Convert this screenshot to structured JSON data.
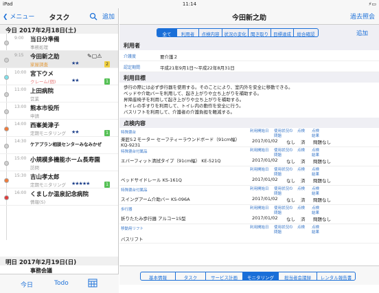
{
  "status": {
    "device": "iPad",
    "time": "11:14"
  },
  "left": {
    "back": "メニュー",
    "title": "タスク",
    "add": "追加",
    "day1": "今日 2017年2月18日(土)",
    "tasks": [
      {
        "time": "9:00",
        "name": "当日分準備",
        "sub": "事務処理",
        "stars": "",
        "badge": "",
        "dot": "#cfcfcf",
        "subcolor": "#999",
        "icons": ""
      },
      {
        "time": "9:15",
        "name": "今田新之助",
        "sub": "家屋調査",
        "stars": "★★",
        "badge": "2",
        "dot": "#cfcfcf",
        "subcolor": "#e39a3a",
        "icons": "✎▢⚠"
      },
      {
        "time": "10:00",
        "name": "宮下ウメ",
        "sub": "クレーム(個)",
        "stars": "★★",
        "badge": "1",
        "dot": "#7fe0ea",
        "subcolor": "#e57a7a",
        "icons": ""
      },
      {
        "time": "11:00",
        "name": "上田病院",
        "sub": "営業",
        "stars": "",
        "badge": "",
        "dot": "#cfcfcf",
        "subcolor": "#999",
        "icons": ""
      },
      {
        "time": "13:00",
        "name": "熊本市役所",
        "sub": "申請",
        "stars": "",
        "badge": "",
        "dot": "#cfcfcf",
        "subcolor": "#999",
        "icons": ""
      },
      {
        "time": "14:00",
        "name": "西峯美津子",
        "sub": "定期モニタリング",
        "stars": "★★",
        "badge": "1",
        "dot": "#f07a3a",
        "subcolor": "#999",
        "icons": ""
      },
      {
        "time": "14:30",
        "name": "ケアプラン相談センターみなみかぜ",
        "sub": "",
        "stars": "",
        "badge": "",
        "dot": "#cfcfcf",
        "subcolor": "#999",
        "icons": ""
      },
      {
        "time": "15:00",
        "name": "小規模多機能ホーム長寿園",
        "sub": "訪問",
        "stars": "",
        "badge": "",
        "dot": "#cfcfcf",
        "subcolor": "#999",
        "icons": ""
      },
      {
        "time": "15:30",
        "name": "吉山孝太郎",
        "sub": "定期モニタリング",
        "stars": "★★★★★",
        "badge": "1",
        "dot": "#f07a3a",
        "subcolor": "#999",
        "icons": ""
      },
      {
        "time": "16:00",
        "name": "くましか温泉記念病院",
        "sub": "情報(S)",
        "stars": "",
        "badge": "",
        "dot": "#e03a3a",
        "subcolor": "#999",
        "icons": ""
      }
    ],
    "day2": "明日 2017年2月19日(日)",
    "last": "事務会議",
    "tab_today": "今日",
    "tab_todo": "Todo"
  },
  "right": {
    "title": "今田新之助",
    "past": "過去照会",
    "add": "追加",
    "segs": [
      "全て",
      "利用者",
      "点検内容",
      "状況の変化",
      "聞き取り",
      "目標達成",
      "総合確認"
    ],
    "sec_user": "利用者",
    "care_label": "介護度",
    "care_value": "要介護２",
    "period_label": "認定期間",
    "period_value": "平成21年9月1日〜平成22年8月31日",
    "sec_goal": "利用目標",
    "goals": [
      "歩行の際には必ず歩行器を使用する。そのことにより、室内外を安全に移動できる。",
      "ベッドや介助バーを利用して、起き上がりや立ち上がりを補助する。",
      "昇降座椅子を利用して起き上がりや立ち上がりを補助する。",
      "トイレの手すりを利用して、トイレ内の動作を安全に行う。",
      "バスリフトを利用して、介護者の介護負担を軽減する。"
    ],
    "sec_check": "点検内容",
    "h_start": "利用開始日",
    "h_status": "使用状況の問題",
    "h_check": "点検",
    "h_result": "点検結果",
    "items": [
      {
        "cat": "特殊寝台",
        "name": "楽匠S２モーター セーフティーラウンドボード（91cm幅） KQ-9231",
        "date": "2017/01/02",
        "c2": "なし",
        "c3": "済",
        "c4": "問題なし"
      },
      {
        "cat": "特殊寝台付属品",
        "name": "エバーフィット清拭タイプ（91cm幅） KE-521Q",
        "date": "2017/01/02",
        "c2": "なし",
        "c3": "済",
        "c4": "問題なし"
      },
      {
        "cat": "",
        "name": "ベッドサイドレール KS-161Q",
        "date": "2017/01/02",
        "c2": "なし",
        "c3": "済",
        "c4": "問題なし"
      },
      {
        "cat": "特殊寝台付属品",
        "name": "スイングアーム介助バー KS-096A",
        "date": "2017/01/02",
        "c2": "なし",
        "c3": "済",
        "c4": "問題なし"
      },
      {
        "cat": "歩行器",
        "name": "折りたたみ歩行器 アルコー1S型",
        "date": "2017/01/02",
        "c2": "なし",
        "c3": "済",
        "c4": "問題なし"
      },
      {
        "cat": "移動用リフト",
        "name": "バスリフト",
        "date": "",
        "c2": "",
        "c3": "",
        "c4": ""
      }
    ],
    "btabs": [
      "基本情報",
      "タスク",
      "サービス計画",
      "モニタリング",
      "担当者会議録",
      "レンタル報告書"
    ]
  },
  "colors": {
    "accent": "#1a6fd8",
    "label": "#3a78c9"
  }
}
